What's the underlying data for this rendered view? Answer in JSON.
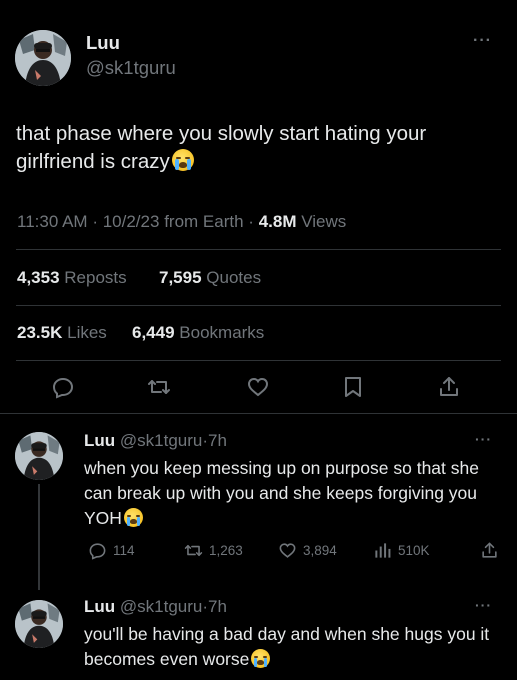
{
  "main_tweet": {
    "name": "Luu",
    "handle": "@sk1tguru",
    "more": "···",
    "text": "that phase where you slowly start hating your girlfriend is crazy",
    "time": "11:30 AM",
    "date": "10/2/23",
    "source": "from Earth",
    "views_count": "4.8M",
    "views_label": "Views",
    "sep": "·",
    "reposts_count": "4,353",
    "reposts_label": "Reposts",
    "quotes_count": "7,595",
    "quotes_label": "Quotes",
    "likes_count": "23.5K",
    "likes_label": "Likes",
    "bookmarks_count": "6,449",
    "bookmarks_label": "Bookmarks",
    "emoji": "loudly-crying-face"
  },
  "actions": [
    "reply-icon",
    "repost-icon",
    "like-icon",
    "bookmark-icon",
    "share-icon"
  ],
  "replies": [
    {
      "name": "Luu",
      "handle": "@sk1tguru",
      "time": "7h",
      "sep": "·",
      "more": "···",
      "text": "when you keep messing up on purpose so that she can break up with you and she keeps forgiving you YOH",
      "replies": "114",
      "reposts": "1,263",
      "likes": "3,894",
      "views": "510K"
    },
    {
      "name": "Luu",
      "handle": "@sk1tguru",
      "time": "7h",
      "sep": "·",
      "more": "···",
      "text": "you'll be having a bad day and when she hugs you it becomes even worse"
    }
  ],
  "colors": {
    "background": "#000000",
    "text": "#e7e9ea",
    "muted": "#71767b",
    "divider": "#2f3336"
  }
}
